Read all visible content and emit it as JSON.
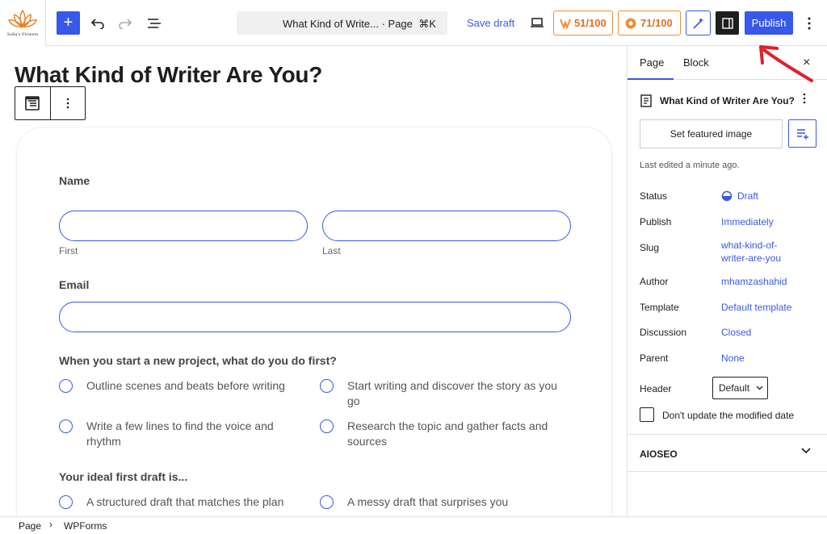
{
  "toolbar": {
    "logo_text": "Sofia's Flowers",
    "add_label": "+",
    "command_title": "What Kind of Write... · Page",
    "command_shortcut": "⌘K",
    "save_draft": "Save draft",
    "score1": "51/100",
    "score2": "71/100",
    "publish": "Publish"
  },
  "editor": {
    "page_title": "What Kind of Writer Are You?",
    "form": {
      "name_label": "Name",
      "first_sub": "First",
      "last_sub": "Last",
      "email_label": "Email",
      "q1": "When you start a new project, what do you do first?",
      "q1_opts": [
        "Outline scenes and beats before writing",
        "Start writing and discover the story as you go",
        "Write a few lines to find the voice and rhythm",
        "Research the topic and gather facts and sources"
      ],
      "q2": "Your ideal first draft is...",
      "q2_opts": [
        "A structured draft that matches the plan",
        "A messy draft that surprises you"
      ]
    }
  },
  "sidebar": {
    "tab_page": "Page",
    "tab_block": "Block",
    "close": "×",
    "doc_title": "What Kind of Writer Are You?",
    "featured_image": "Set featured image",
    "last_edited": "Last edited a minute ago.",
    "meta": [
      {
        "key": "Status",
        "value": "Draft"
      },
      {
        "key": "Publish",
        "value": "Immediately"
      },
      {
        "key": "Slug",
        "value": "what-kind-of-writer-are-you"
      },
      {
        "key": "Author",
        "value": "mhamzashahid"
      },
      {
        "key": "Template",
        "value": "Default template"
      },
      {
        "key": "Discussion",
        "value": "Closed"
      },
      {
        "key": "Parent",
        "value": "None"
      }
    ],
    "header_label": "Header",
    "header_value": "Default",
    "modified_date_label": "Don't update the modified date",
    "aioseo": "AIOSEO"
  },
  "footer": {
    "crumb1": "Page",
    "separator": "›",
    "crumb2": "WPForms"
  },
  "colors": {
    "accent": "#3858e9",
    "score": "#e26f21",
    "arrow": "#e0202a"
  }
}
